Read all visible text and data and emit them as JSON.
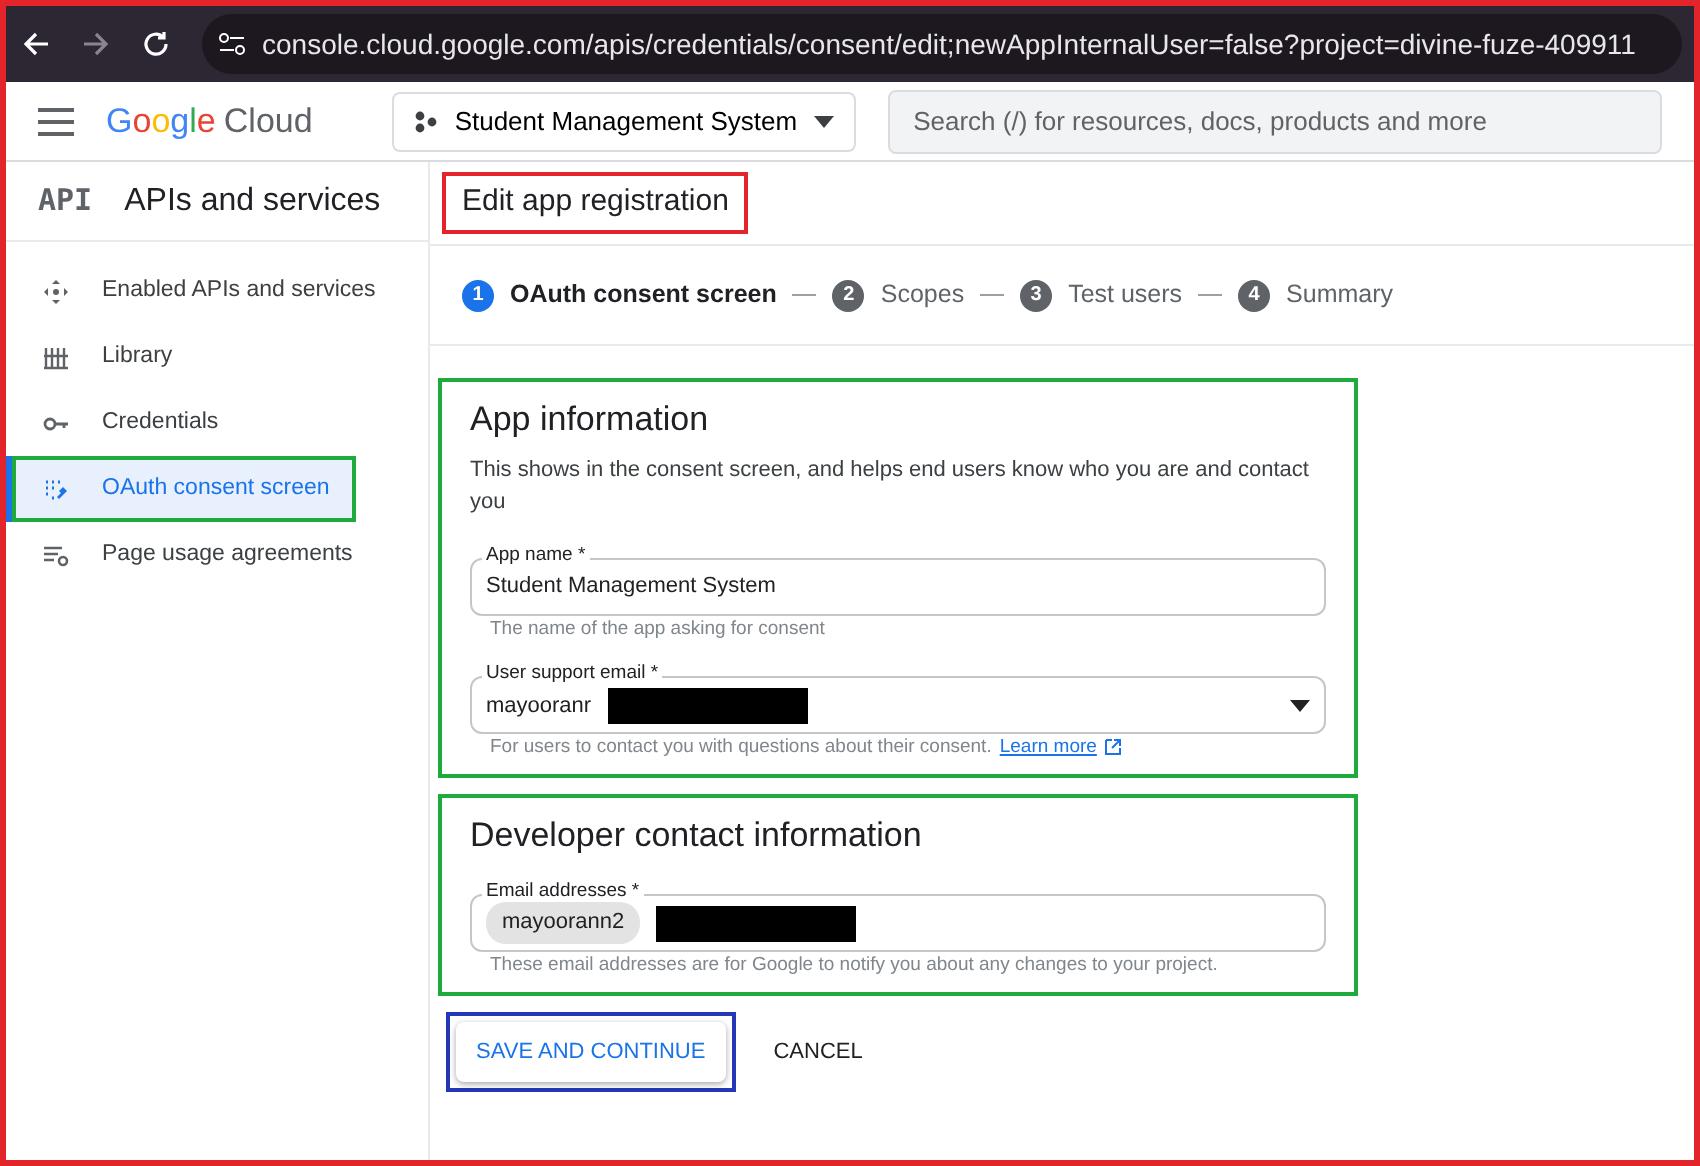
{
  "window": {
    "annotated": true
  },
  "browser": {
    "url": "console.cloud.google.com/apis/credentials/consent/edit;newAppInternalUser=false?project=divine-fuze-409911"
  },
  "header": {
    "logo_google": "Google",
    "logo_cloud": "Cloud",
    "project": "Student Management System",
    "search": {
      "placeholder": "Search (/) for resources, docs, products and more"
    }
  },
  "sidebar": {
    "badge": "API",
    "title": "APIs and services",
    "items": [
      {
        "label": "Enabled APIs and services",
        "selected": false,
        "annotated": false
      },
      {
        "label": "Library",
        "selected": false,
        "annotated": false
      },
      {
        "label": "Credentials",
        "selected": false,
        "annotated": false
      },
      {
        "label": "OAuth consent screen",
        "selected": true,
        "annotated": true
      },
      {
        "label": "Page usage agreements",
        "selected": false,
        "annotated": false
      }
    ]
  },
  "page": {
    "title": "Edit app registration",
    "annotated": true
  },
  "steps": [
    {
      "number": "1",
      "label": "OAuth consent screen",
      "selected": true
    },
    {
      "number": "2",
      "label": "Scopes",
      "selected": false
    },
    {
      "number": "3",
      "label": "Test users",
      "selected": false
    },
    {
      "number": "4",
      "label": "Summary",
      "selected": false
    }
  ],
  "sections": [
    {
      "title": "App information",
      "annotated": true,
      "description": "This shows in the consent screen, and helps end users know who you are and contact you",
      "fields": [
        {
          "kind": "text",
          "label": "App name *",
          "value": "Student Management System",
          "hint": "The name of the app asking for consent"
        },
        {
          "kind": "select",
          "label": "User support email *",
          "value": "mayooranr",
          "redacted": true,
          "hint": "For users to contact you with questions about their consent.",
          "link": "Learn more"
        }
      ]
    },
    {
      "title": "Developer contact information",
      "annotated": true,
      "fields": [
        {
          "kind": "chips",
          "label": "Email addresses *",
          "value": "mayoorann2",
          "redacted": true,
          "hint": "These email addresses are for Google to notify you about any changes to your project."
        }
      ]
    }
  ],
  "actions": [
    {
      "kind": "primary",
      "label": "SAVE AND CONTINUE",
      "annotated": true
    },
    {
      "kind": "text",
      "label": "CANCEL"
    }
  ]
}
